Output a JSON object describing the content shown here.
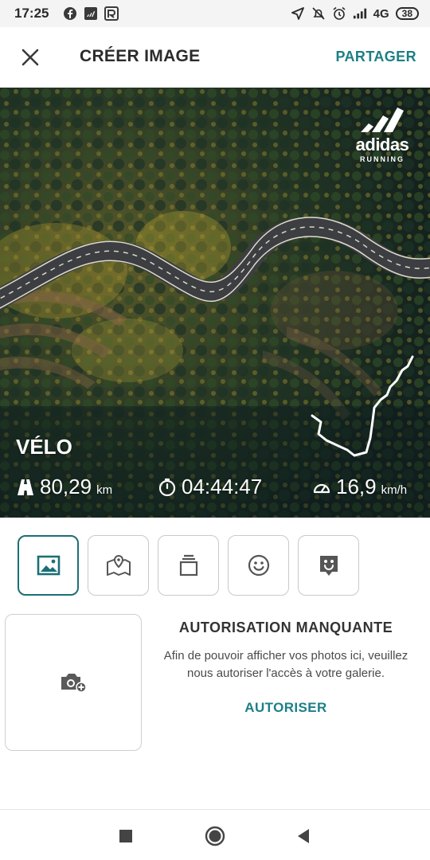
{
  "status_bar": {
    "time": "17:25",
    "network": "4G",
    "battery": "38",
    "icons": [
      "facebook-icon",
      "adidas-icon",
      "runtastic-icon",
      "location-arrow-icon",
      "muted-bell-icon",
      "alarm-icon",
      "signal-icon"
    ]
  },
  "header": {
    "title": "CRÉER IMAGE",
    "share_label": "PARTAGER",
    "close_icon": "close-icon"
  },
  "photo": {
    "brand": {
      "word": "adidas",
      "sub": "RUNNING"
    },
    "activity": "VÉLO",
    "stats": [
      {
        "icon": "road-icon",
        "value": "80,29",
        "unit": "km"
      },
      {
        "icon": "stopwatch-icon",
        "value": "04:44:47",
        "unit": ""
      },
      {
        "icon": "speedometer-icon",
        "value": "16,9",
        "unit": "km/h"
      }
    ]
  },
  "tools": [
    {
      "name": "background-image-tool",
      "icon": "image-icon",
      "active": true
    },
    {
      "name": "map-tool",
      "icon": "map-icon",
      "active": false
    },
    {
      "name": "frame-tool",
      "icon": "layers-icon",
      "active": false
    },
    {
      "name": "emoji-tool",
      "icon": "smiley-icon",
      "active": false
    },
    {
      "name": "sticker-tool",
      "icon": "sticker-icon",
      "active": false
    }
  ],
  "permission": {
    "title": "AUTORISATION MANQUANTE",
    "message": "Afin de pouvoir afficher vos photos ici, veuillez nous autoriser l'accès à votre galerie.",
    "action": "AUTORISER"
  },
  "colors": {
    "accent": "#1c7f86",
    "active_border": "#1c6f76"
  }
}
